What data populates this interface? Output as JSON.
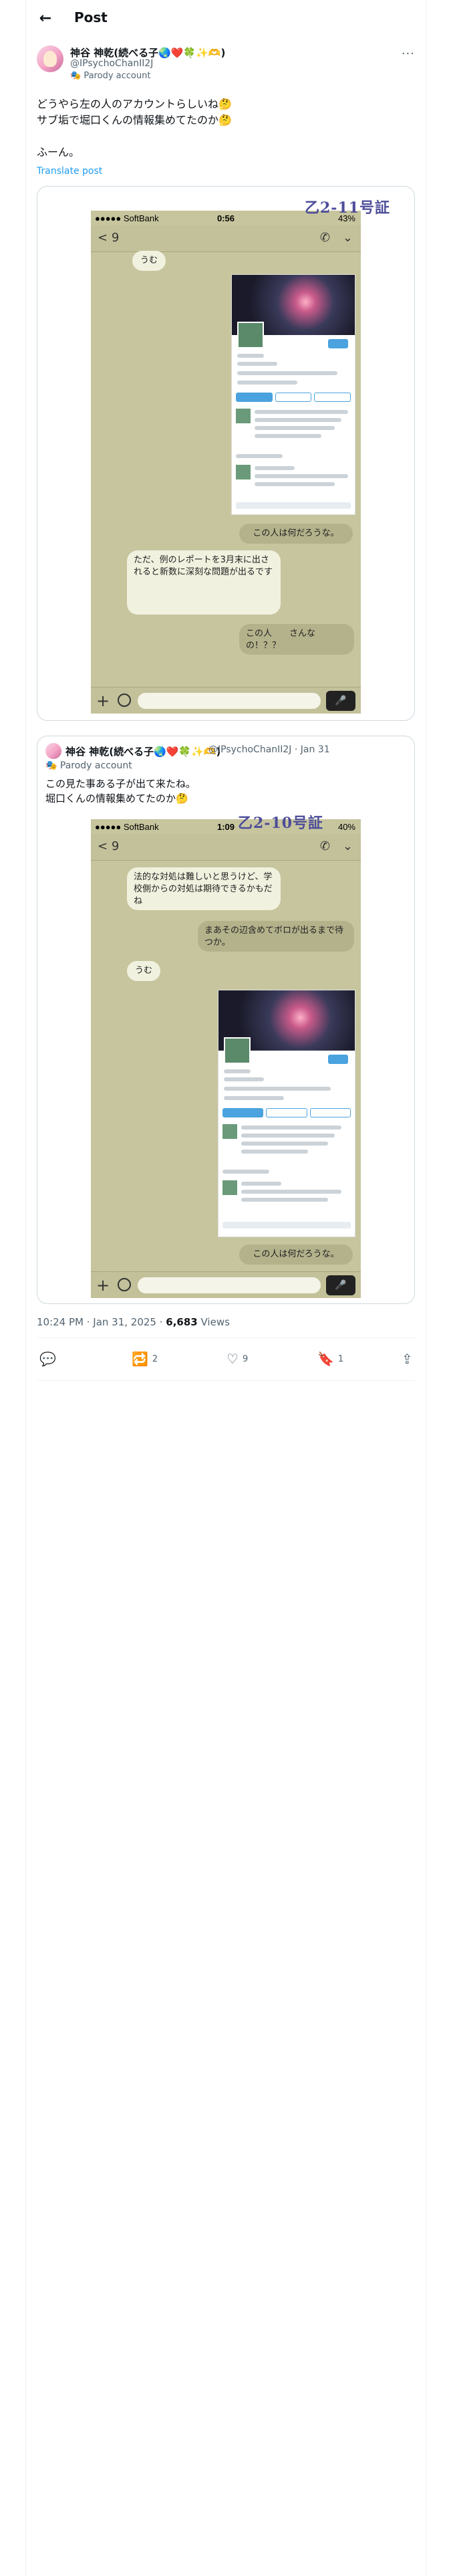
{
  "header": {
    "title": "Post",
    "back_icon": "arrow-left-icon"
  },
  "author": {
    "name": "神谷 神乾(続べる子🌏❤️🍀✨🫶)",
    "handle": "@IPsychoChanII2J",
    "badge": "Parody account"
  },
  "post": {
    "line1": "どうやら左の人のアカウントらしいね🤔",
    "line2": "サブ垢で堀口くんの情報集めてたのか🤔",
    "line3": "ふーん。",
    "translate": "Translate post"
  },
  "image1": {
    "stamp": "乙2-11号証",
    "status_carrier": "●●●●● SoftBank",
    "status_time": "0:56",
    "status_battery": "43%",
    "nav_count": "9",
    "bubble_top": "うむ",
    "bubble_out1": "この人は何だろうな。",
    "bubble_in1": "ただ、例のレポートを3月末に出されると新数に深刻な問題が出るです",
    "bubble_out2": "この人　　さんなの！？？"
  },
  "quote": {
    "name": "神谷 神乾(続べる子🌏❤️🍀✨🫶)",
    "handle": "@IPsychoChanII2J · Jan 31",
    "badge": "Parody account",
    "line1": "この見た事ある子が出て来たね。",
    "line2": "堀口くんの情報集めてたのか🤔"
  },
  "image2": {
    "stamp": "乙2-10号証",
    "status_carrier": "●●●●● SoftBank",
    "status_time": "1:09",
    "status_battery": "40%",
    "nav_count": "9",
    "bubble_in1": "法的な対処は難しいと思うけど、学校側からの対処は期待できるかもだね",
    "bubble_out1": "まあその辺含めてボロが出るまで待つか。",
    "bubble_in2": "うむ",
    "bubble_out2": "この人は何だろうな。"
  },
  "meta": {
    "time": "10:24 PM · Jan 31, 2025 · ",
    "views_count": "6,683",
    "views_label": " Views"
  },
  "actions": {
    "replies": "",
    "reposts": "2",
    "likes": "9",
    "bookmarks": "1"
  }
}
